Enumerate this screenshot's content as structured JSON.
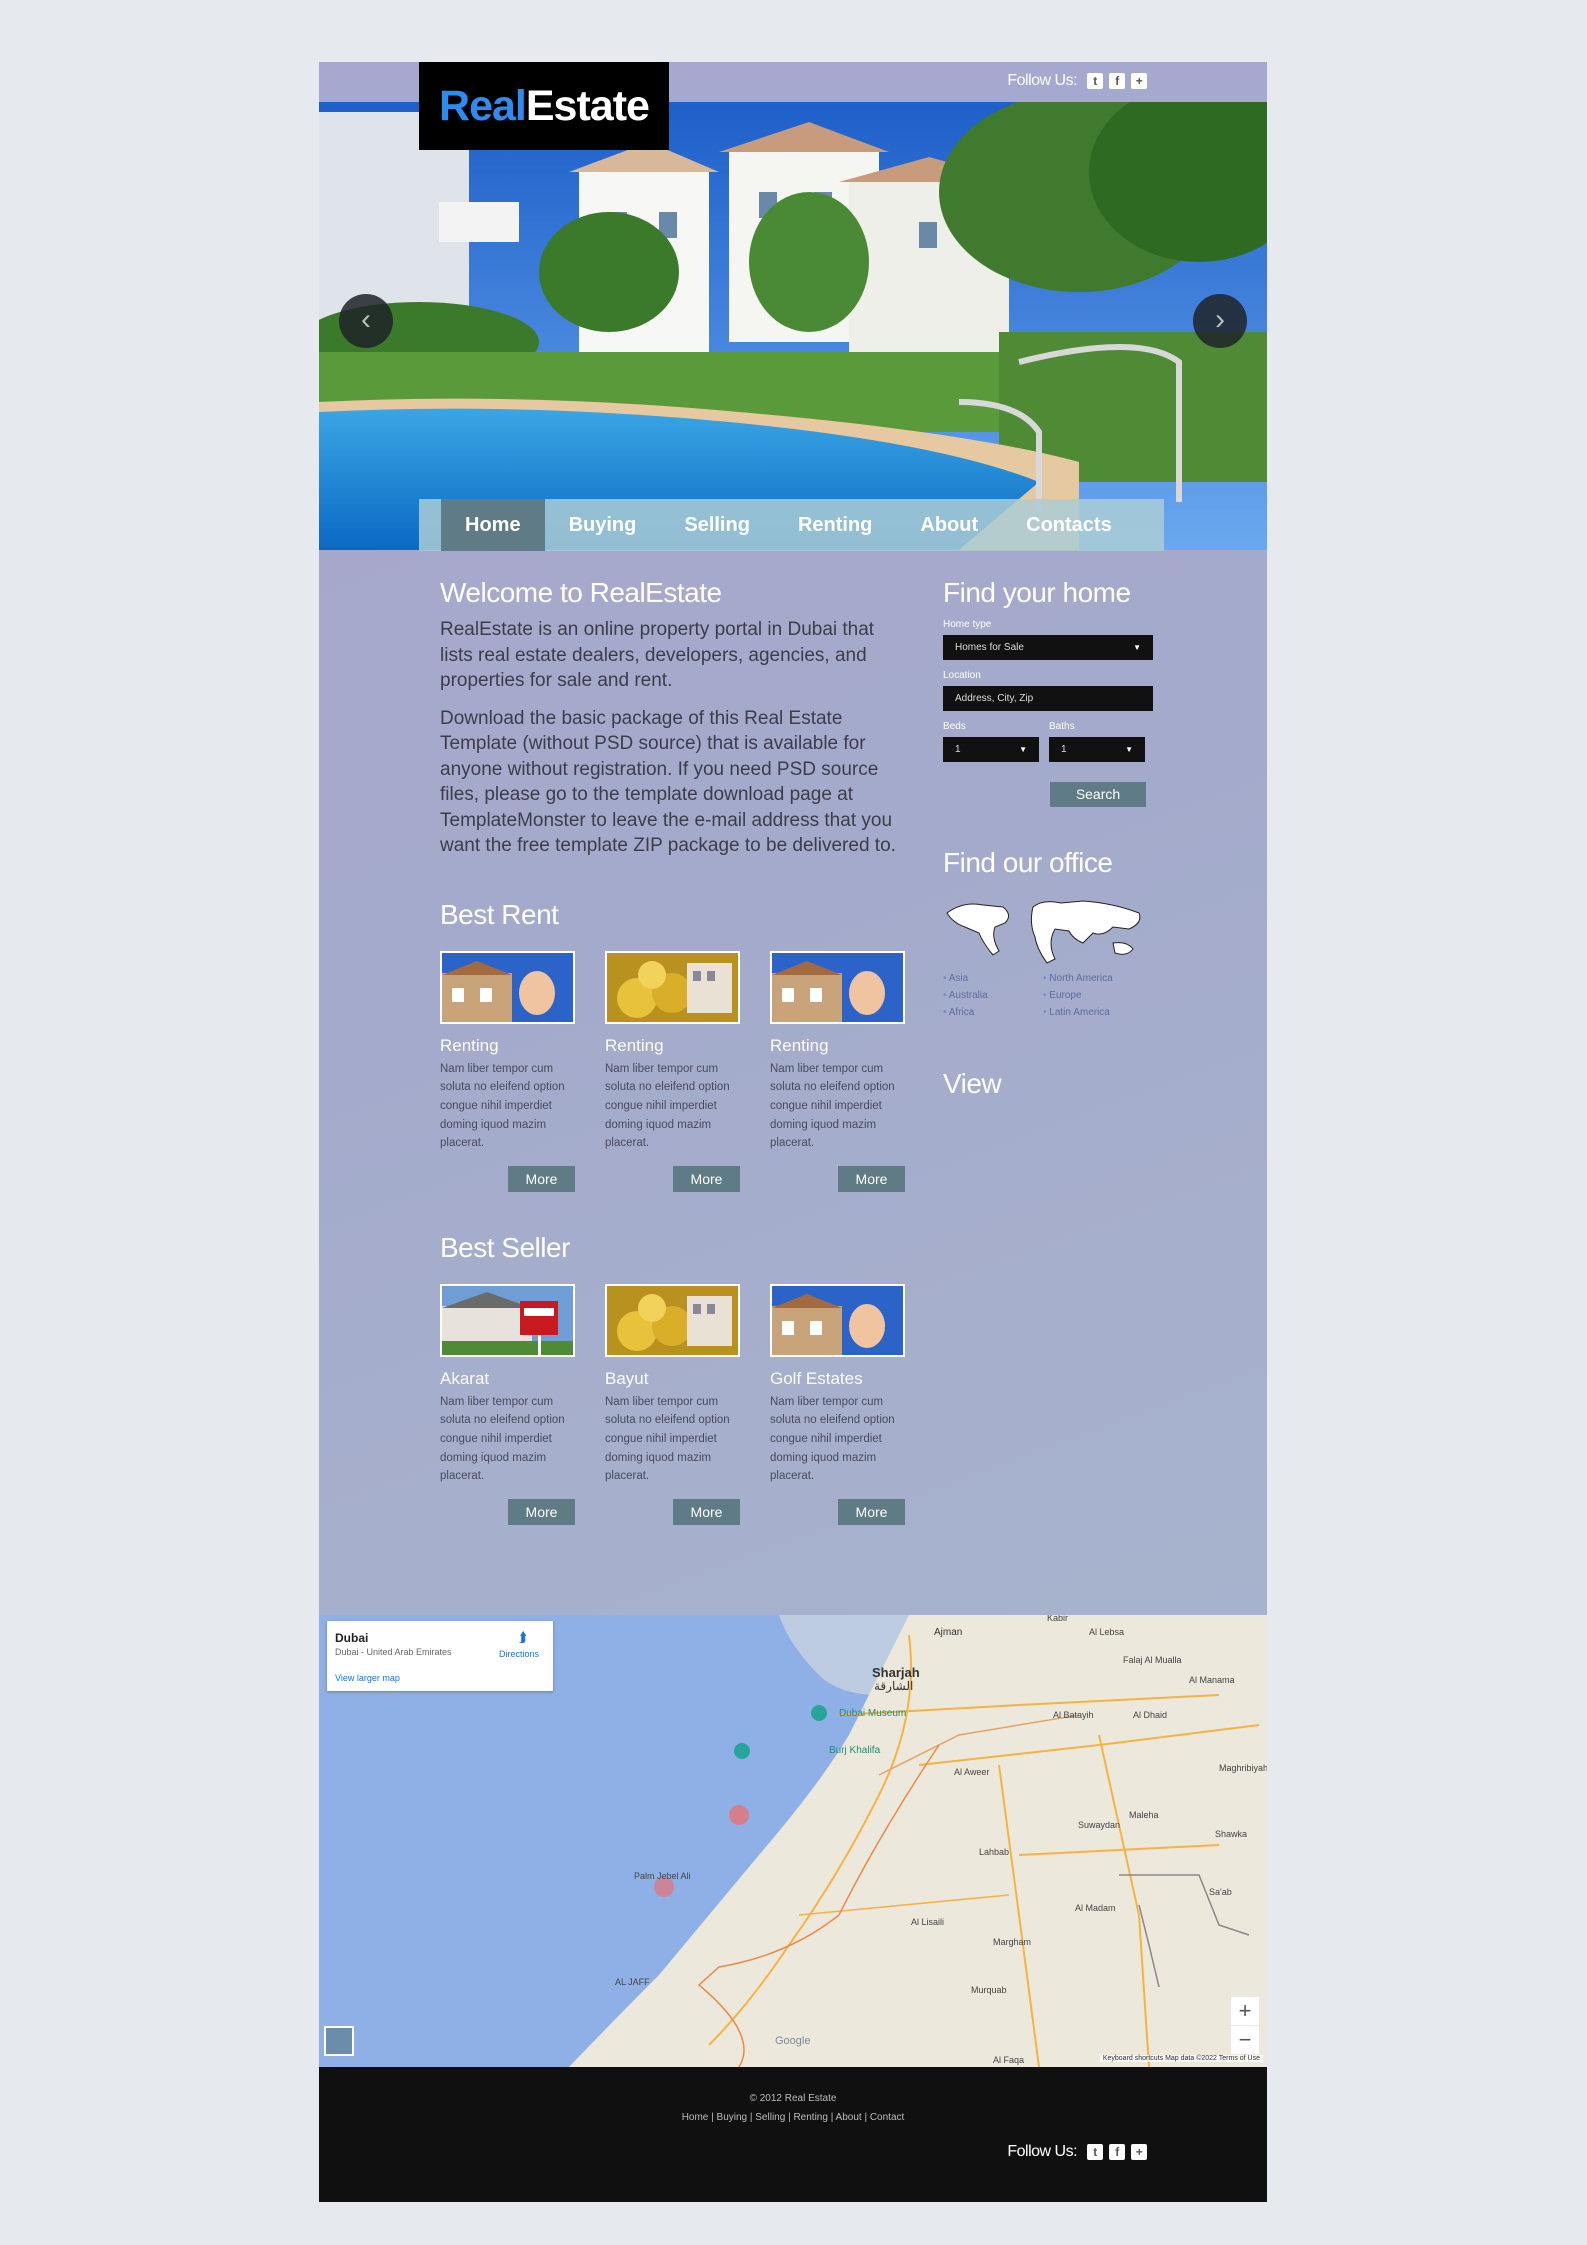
{
  "logo": {
    "part1": "Real",
    "part2": "Estate"
  },
  "header": {
    "follow_label": "Follow Us:",
    "social": [
      "twitter-icon",
      "facebook-icon",
      "plus-icon"
    ]
  },
  "hero": {
    "prev_glyph": "‹",
    "next_glyph": "›"
  },
  "nav": [
    "Home",
    "Buying",
    "Selling",
    "Renting",
    "About",
    "Contacts"
  ],
  "welcome": {
    "title": "Welcome to RealEstate",
    "p1": "RealEstate is an online property portal in Dubai that lists real estate dealers, developers, agencies, and properties for sale and rent.",
    "p2": "Download the basic package of this Real Estate Template (without PSD source) that is available for anyone without registration. If you need PSD source files, please go to the template download page at TemplateMonster to leave the e-mail address that you want the free template ZIP package to be delivered to."
  },
  "best_rent": {
    "title": "Best Rent",
    "items": [
      {
        "title": "Renting",
        "text": "Nam liber tempor cum soluta no eleifend option congue nihil imperdiet doming iquod mazim placerat.",
        "button": "More"
      },
      {
        "title": "Renting",
        "text": "Nam liber tempor cum soluta no eleifend option congue nihil imperdiet doming iquod mazim placerat.",
        "button": "More"
      },
      {
        "title": "Renting",
        "text": "Nam liber tempor cum soluta no eleifend option congue nihil imperdiet doming iquod mazim placerat.",
        "button": "More"
      }
    ]
  },
  "best_seller": {
    "title": "Best Seller",
    "items": [
      {
        "title": "Akarat",
        "text": "Nam liber tempor cum soluta no eleifend option congue nihil imperdiet doming iquod mazim placerat.",
        "button": "More"
      },
      {
        "title": "Bayut",
        "text": "Nam liber tempor cum soluta no eleifend option congue nihil imperdiet doming iquod mazim placerat.",
        "button": "More"
      },
      {
        "title": "Golf Estates",
        "text": "Nam liber tempor cum soluta no eleifend option congue nihil imperdiet doming iquod mazim placerat.",
        "button": "More"
      }
    ]
  },
  "find_home": {
    "title": "Find your home",
    "home_type_label": "Home type",
    "home_type_value": "Homes for Sale",
    "location_label": "Location",
    "location_placeholder": "Address, City, Zip",
    "beds_label": "Beds",
    "beds_value": "1",
    "baths_label": "Baths",
    "baths_value": "1",
    "search_label": "Search"
  },
  "find_office": {
    "title": "Find our office",
    "regions": [
      "Asia",
      "North America",
      "Australia",
      "Europe",
      "Africa",
      "Latin America"
    ]
  },
  "view": {
    "title": "View"
  },
  "map": {
    "place": "Dubai",
    "address": "Dubai - United Arab Emirates",
    "larger_link": "View larger map",
    "directions": "Directions",
    "city_sharjah": "Sharjah",
    "city_sharjah_ar": "الشارقة",
    "ajman": "Ajman",
    "museum": "Dubai Museum",
    "burj": "Burj Khalifa",
    "palm": "Palm Jebel Ali",
    "al_aweer": "Al Aweer",
    "lahbab": "Lahbab",
    "al_lisaili": "Al Lisaili",
    "margham": "Margham",
    "murquab": "Murquab",
    "al_madam": "Al Madam",
    "al_faqa": "Al Faqa",
    "maleha": "Maleha",
    "swaydan": "Suwaydan",
    "al_dhaid": "Al Dhaid",
    "al_manama": "Al Manama",
    "al_batayih": "Al Batayih",
    "falaj": "Falaj Al Mualla",
    "al_lebsa": "Al Lebsa",
    "kabir": "Kabir",
    "shawka": "Shawka",
    "sa_ab": "Sa'ab",
    "maghribiyah": "Maghribiyah",
    "jebel_ali": "AL JAFF",
    "google": "Google",
    "footer_note": "Keyboard shortcuts   Map data ©2022   Terms of Use",
    "zoom_in": "+",
    "zoom_out": "−"
  },
  "footer": {
    "copyright": "© 2012 Real Estate",
    "links": [
      "Home",
      "Buying",
      "Selling",
      "Renting",
      "About",
      "Contact"
    ],
    "follow_label": "Follow Us:"
  }
}
